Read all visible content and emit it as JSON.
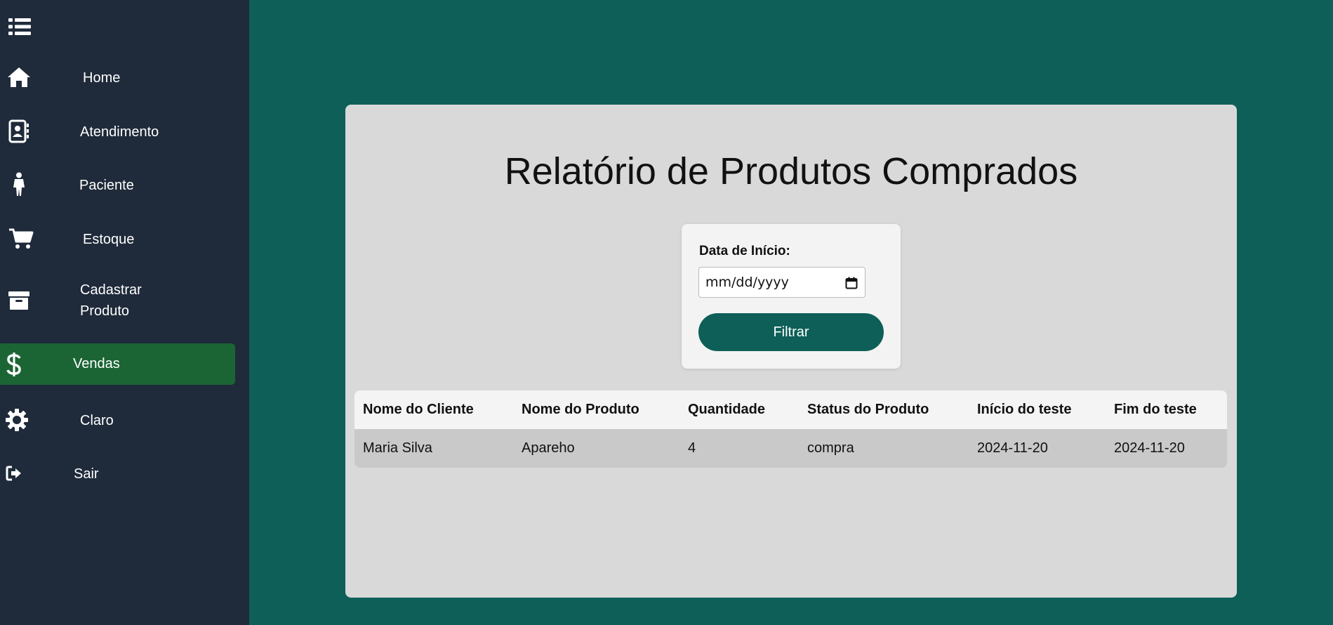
{
  "sidebar": {
    "items": [
      {
        "label": "Home",
        "icon": "home-icon"
      },
      {
        "label": "Atendimento",
        "icon": "contact-book-icon"
      },
      {
        "label": "Paciente",
        "icon": "person-icon"
      },
      {
        "label": "Estoque",
        "icon": "cart-icon"
      },
      {
        "label": "Cadastrar",
        "label2": "Produto",
        "icon": "archive-box-icon"
      },
      {
        "label": "Vendas",
        "icon": "dollar-icon",
        "active": true
      },
      {
        "label": "Claro",
        "icon": "gear-icon"
      },
      {
        "label": "Sair",
        "icon": "sign-out-icon"
      }
    ]
  },
  "main": {
    "title": "Relatório de Produtos Comprados",
    "filter": {
      "label": "Data de Início:",
      "placeholder": "mm/dd/yyyy",
      "button": "Filtrar"
    },
    "table": {
      "headers": [
        "Nome do Cliente",
        "Nome do Produto",
        "Quantidade",
        "Status do Produto",
        "Início do teste",
        "Fim do teste"
      ],
      "rows": [
        [
          "Maria Silva",
          "Apareho",
          "4",
          "compra",
          "2024-11-20",
          "2024-11-20"
        ]
      ]
    }
  },
  "colors": {
    "background": "#0e5f57",
    "sidebar": "#1f2a3a",
    "active_item": "#1b6535",
    "panel": "#d9d9d9",
    "button": "#0e5f57"
  }
}
